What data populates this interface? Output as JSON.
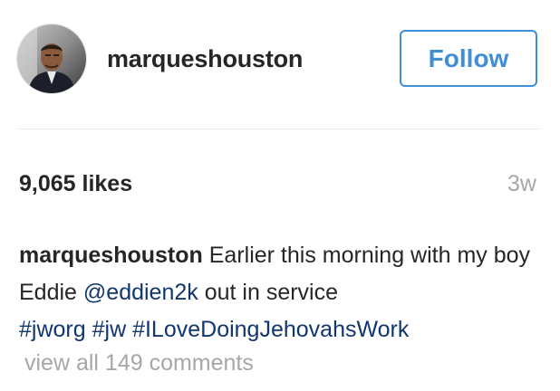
{
  "post": {
    "username": "marqueshouston",
    "follow_label": "Follow",
    "likes_text": "9,065 likes",
    "timestamp": "3w",
    "caption": {
      "username": "marqueshouston",
      "text_before_mention": "Earlier this morning with my boy Eddie",
      "mention": "@eddien2k",
      "text_after_mention": "out in service",
      "hashtags": [
        "#jworg",
        "#jw",
        "#ILoveDoingJehovahsWork"
      ]
    },
    "view_comments_text": "view all 149 comments"
  },
  "colors": {
    "link_blue": "#12376f",
    "follow_blue": "#3f8ed6",
    "muted_gray": "#a5a7aa",
    "text_dark": "#262626"
  },
  "icons": {
    "avatar": "profile-photo"
  }
}
